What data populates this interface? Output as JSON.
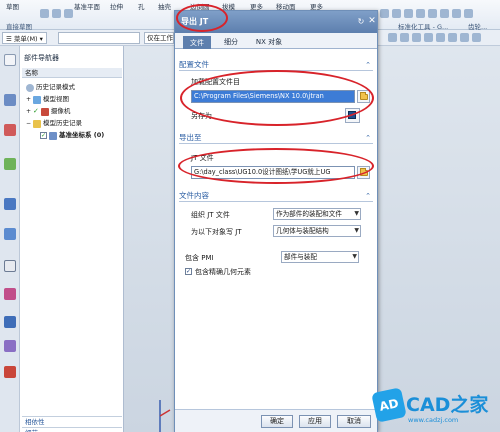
{
  "ribbon": {
    "items": [
      "草图",
      "基准平面",
      "拉伸",
      "孔",
      "抽壳",
      "边倒圆",
      "拔模",
      "更多",
      "移动面",
      "更多"
    ],
    "groups": [
      "直接草图",
      "标准化工具 - G...",
      "齿轮..."
    ]
  },
  "cmdbar": {
    "menu_label": "菜单(M)",
    "combo_left_value": "",
    "combo_right_value": "仅在工作"
  },
  "navigator": {
    "title": "部件导航器",
    "column_header": "名称",
    "items": [
      {
        "label": "历史记录模式"
      },
      {
        "label": "模型视图"
      },
      {
        "label": "摄像机"
      },
      {
        "label": "模型历史记录"
      },
      {
        "label": "基准坐标系 (0)"
      }
    ],
    "footer_1": "相依性",
    "footer_2": "细节"
  },
  "dialog": {
    "title": "导出 JT",
    "tabs": [
      "文件",
      "细分",
      "NX 对象"
    ],
    "config_section": {
      "title": "配置文件",
      "load_label": "加载配置文件目",
      "load_value": "C:\\Program Files\\Siemens\\NX 10.0\\jtran",
      "saveas_label": "另存为"
    },
    "export_section": {
      "title": "导出至",
      "jt_label": "JT 文件",
      "jt_value": "G:\\day_class\\UG10.0设计图纸\\学UG就上UG"
    },
    "content_section": {
      "title": "文件内容",
      "organize_label": "组织 JT 文件",
      "organize_value": "作为部件的装配和文件",
      "write_label": "为以下对象写 JT",
      "write_value": "几何体与装配结构",
      "pmi_label": "包含 PMI",
      "pmi_value": "部件与装配",
      "exact_label": "包含精确几何元素",
      "exact_checked": true
    },
    "buttons": {
      "ok": "确定",
      "apply": "应用",
      "cancel": "取消"
    }
  },
  "watermark": {
    "logo": "AD",
    "text": "CAD之家",
    "url": "www.cadzj.com"
  }
}
